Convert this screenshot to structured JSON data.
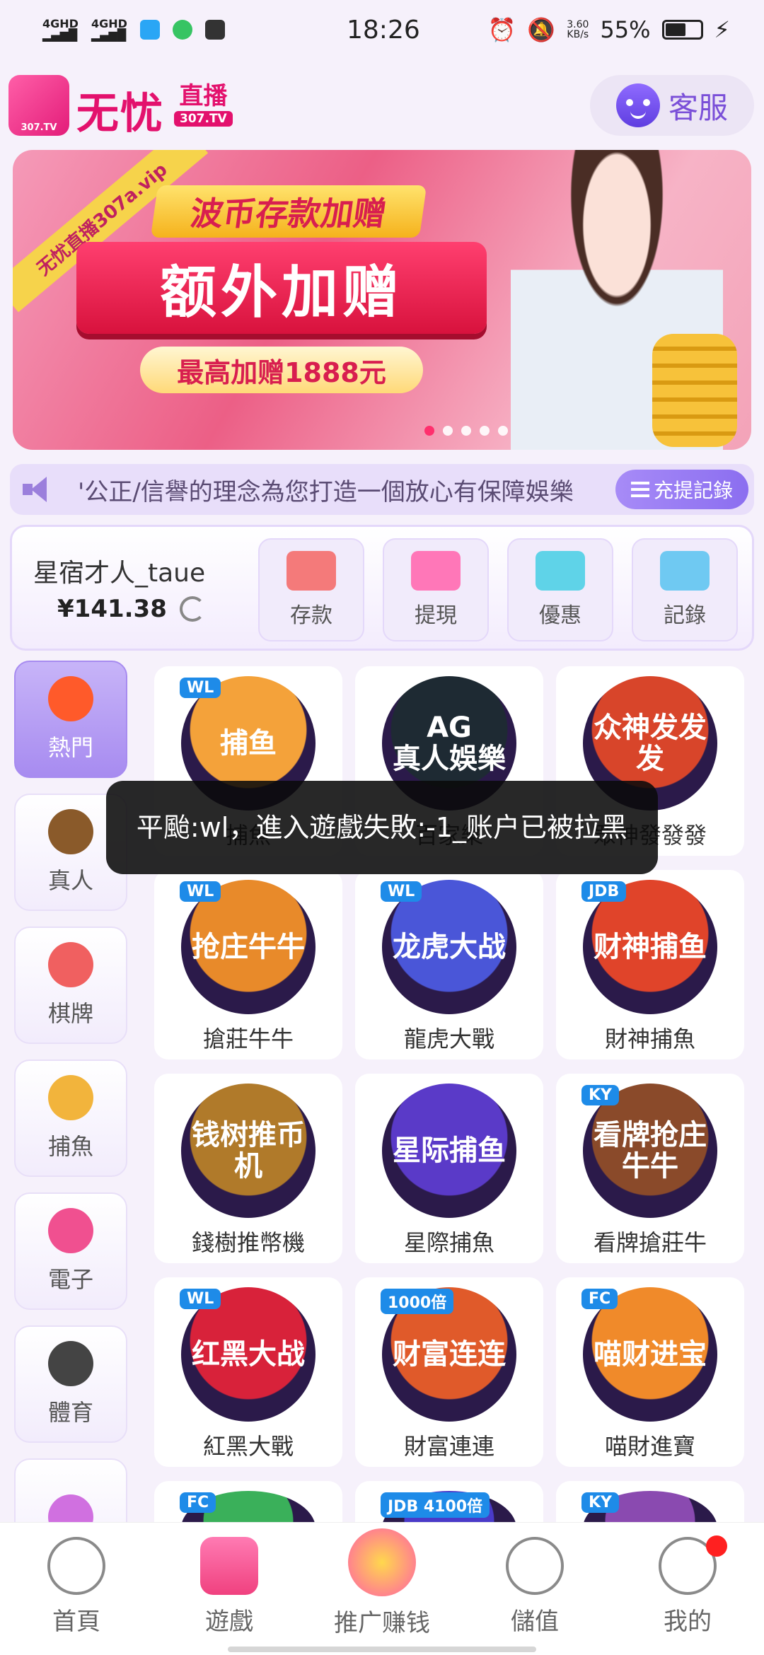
{
  "status_bar": {
    "time": "18:26",
    "network_1": "4GHD",
    "network_2": "4GHD",
    "speed_value": "3.60",
    "speed_unit": "KB/s",
    "battery": "55%"
  },
  "header": {
    "logo_title": "无忧",
    "logo_sub": "直播",
    "logo_domain": "307.TV",
    "logo_badge": "307.TV",
    "service_label": "客服"
  },
  "banner": {
    "ribbon": "无忧直播307a.vip",
    "tag": "波币存款加赠",
    "main": "额外加赠",
    "sub": "最高加赠1888元",
    "dots_total": 5,
    "active_dot": 0
  },
  "notice": {
    "text": "'公正/信譽的理念為您打造一個放心有保障娛樂",
    "record_label": "充提記錄"
  },
  "user": {
    "name": "星宿才人_taue",
    "balance": "¥141.38",
    "actions": [
      {
        "label": "存款",
        "icon": "wallet-icon",
        "color": "#f47a7a"
      },
      {
        "label": "提現",
        "icon": "money-bag-icon",
        "color": "#ff77b8"
      },
      {
        "label": "優惠",
        "icon": "gift-icon",
        "color": "#5fd3e8"
      },
      {
        "label": "記錄",
        "icon": "bar-chart-icon",
        "color": "#6fc9f2"
      }
    ]
  },
  "side_menu": [
    {
      "label": "熱門",
      "icon": "fire-icon",
      "color": "#ff5a2a",
      "active": true
    },
    {
      "label": "真人",
      "icon": "chip-icon",
      "color": "#8a5a2a",
      "active": false
    },
    {
      "label": "棋牌",
      "icon": "card-icon",
      "color": "#f06060",
      "active": false
    },
    {
      "label": "捕魚",
      "icon": "fish-icon",
      "color": "#f2b43c",
      "active": false
    },
    {
      "label": "電子",
      "icon": "slot-icon",
      "color": "#f05090",
      "active": false
    },
    {
      "label": "體育",
      "icon": "soccer-ball-icon",
      "color": "#444444",
      "active": false
    },
    {
      "label": "",
      "icon": "lottery-ball-icon",
      "color": "#d070e0",
      "active": false
    }
  ],
  "games": [
    {
      "name": "捕魚",
      "art": "捕鱼",
      "badge": "WL",
      "color": "#f4a23a"
    },
    {
      "name": "百家樂",
      "art": "AG\n真人娛樂",
      "badge": "",
      "color": "#1e2a33"
    },
    {
      "name": "眾神發發發",
      "art": "众神发发发",
      "badge": "",
      "color": "#d8452a"
    },
    {
      "name": "搶莊牛牛",
      "art": "抢庄牛牛",
      "badge": "WL",
      "color": "#e88a2a"
    },
    {
      "name": "龍虎大戰",
      "art": "龙虎大战",
      "badge": "WL",
      "color": "#4a56d8"
    },
    {
      "name": "財神捕魚",
      "art": "财神捕鱼",
      "badge": "JDB",
      "color": "#e0442a"
    },
    {
      "name": "錢樹推幣機",
      "art": "钱树推币机",
      "badge": "",
      "color": "#b07a2a"
    },
    {
      "name": "星際捕魚",
      "art": "星际捕鱼",
      "badge": "",
      "color": "#5a3ac8"
    },
    {
      "name": "看牌搶莊牛",
      "art": "看牌抢庄牛牛",
      "badge": "KY",
      "color": "#8a4a2a"
    },
    {
      "name": "紅黑大戰",
      "art": "红黑大战",
      "badge": "WL",
      "color": "#d8223a"
    },
    {
      "name": "財富連連",
      "art": "财富连连",
      "badge": "1000倍",
      "color": "#e05a2a"
    },
    {
      "name": "喵財進寶",
      "art": "喵财进宝",
      "badge": "FC",
      "color": "#f08a2a"
    }
  ],
  "partial_games": [
    {
      "badge": "FC",
      "color": "#3ab05a"
    },
    {
      "badge": "JDB 4100倍",
      "color": "#4a3ac8"
    },
    {
      "badge": "KY",
      "color": "#8a4ab0"
    }
  ],
  "toast": {
    "text": "平颱:wl，進入遊戲失敗:-1_账户已被拉黑"
  },
  "bottom_nav": [
    {
      "label": "首頁",
      "icon": "home-girl-icon"
    },
    {
      "label": "遊戲",
      "icon": "gamepad-icon"
    },
    {
      "label": "推广赚钱",
      "icon": "promo-icon"
    },
    {
      "label": "儲值",
      "icon": "yen-plus-icon"
    },
    {
      "label": "我的",
      "icon": "user-icon"
    }
  ]
}
